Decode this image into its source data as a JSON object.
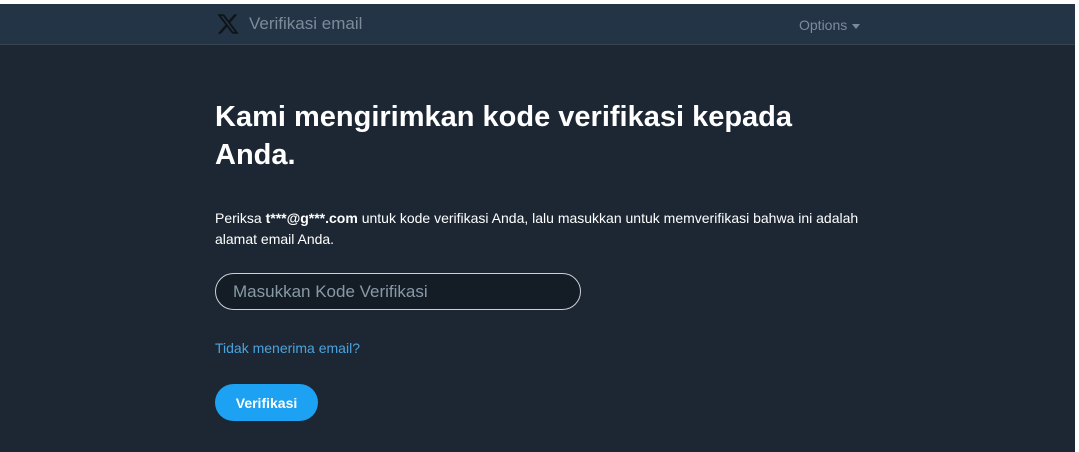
{
  "header": {
    "logo_icon": "x-logo-icon",
    "title": "Verifikasi email",
    "options_label": "Options",
    "options_icon": "caret-down-icon"
  },
  "main": {
    "heading": "Kami mengirimkan kode verifikasi kepada Anda.",
    "description": {
      "prefix": "Periksa ",
      "email": "t***@g***.com",
      "suffix": " untuk kode verifikasi Anda, lalu masukkan untuk memverifikasi bahwa ini adalah alamat email Anda."
    },
    "code_input": {
      "placeholder": "Masukkan Kode Verifikasi",
      "value": ""
    },
    "resend_link": "Tidak menerima email?",
    "verify_button": "Verifikasi"
  },
  "colors": {
    "background": "#1c2733",
    "header": "#243447",
    "accent": "#1da1f2",
    "link": "#4aa3df"
  }
}
